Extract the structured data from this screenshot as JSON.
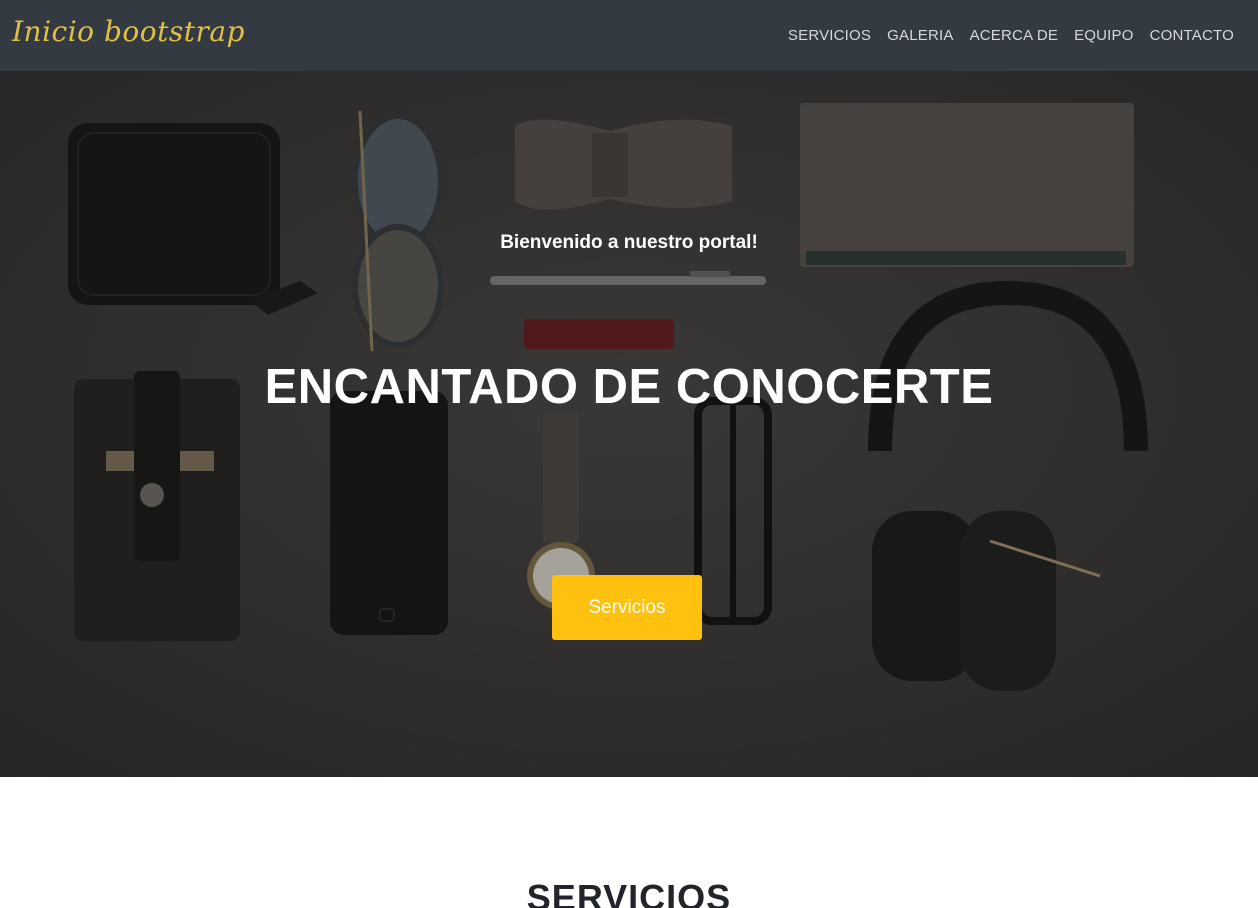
{
  "navbar": {
    "brand": "Inicio bootstrap",
    "links": [
      "SERVICIOS",
      "GALERIA",
      "ACERCA DE",
      "EQUIPO",
      "CONTACTO"
    ]
  },
  "hero": {
    "subtitle": "Bienvenido a nuestro portal!",
    "title": "ENCANTADO DE CONOCERTE",
    "button_label": "Servicios"
  },
  "services": {
    "heading": "SERVICIOS"
  },
  "colors": {
    "navbar_bg": "#343a42",
    "brand": "#e1bf47",
    "accent": "#fec110",
    "hero_overlay": "#2b2a29"
  }
}
